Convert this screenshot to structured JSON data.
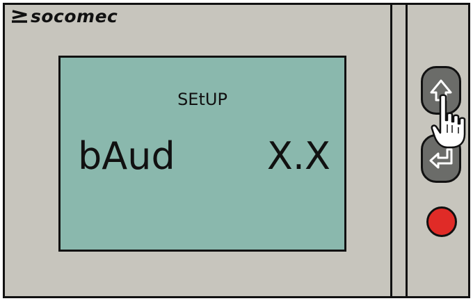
{
  "brand": {
    "name": "socomec"
  },
  "display": {
    "menu_label": "SEtUP",
    "parameter": "bAud",
    "value": "X.X"
  },
  "buttons": {
    "up": {
      "icon": "up-arrow-icon"
    },
    "enter": {
      "icon": "enter-return-icon"
    }
  },
  "indicator": {
    "icon": "red-indicator-button",
    "color": "#e02b27"
  },
  "pointer": {
    "icon": "hand-pointer-icon"
  },
  "colors": {
    "housing": "#c7c5bd",
    "lcd": "#8ab8ad",
    "button": "#6b6c69"
  }
}
